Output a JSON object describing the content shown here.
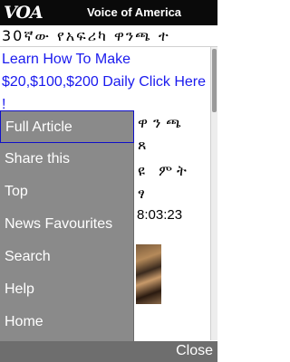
{
  "header": {
    "logo": "VOA",
    "station_name": "Voice of America"
  },
  "article": {
    "title": "30ኛው የአፍሪካ ዋንጫ ተ",
    "ad_link_text": "Learn How To Make $20,$100,$200 Daily Click Here !",
    "visible_fragments": [
      "ዋንጫ",
      "ጸ",
      "ዩ ምት",
      "ፃ"
    ],
    "timestamp_fragment": "8:03:23"
  },
  "menu": {
    "items": [
      {
        "label": "Full Article"
      },
      {
        "label": "Share this"
      },
      {
        "label": "Top"
      },
      {
        "label": "News Favourites"
      },
      {
        "label": "Search"
      },
      {
        "label": "Help"
      },
      {
        "label": "Home"
      }
    ],
    "selected_index": 0
  },
  "softkeys": {
    "right_label": "Close"
  }
}
